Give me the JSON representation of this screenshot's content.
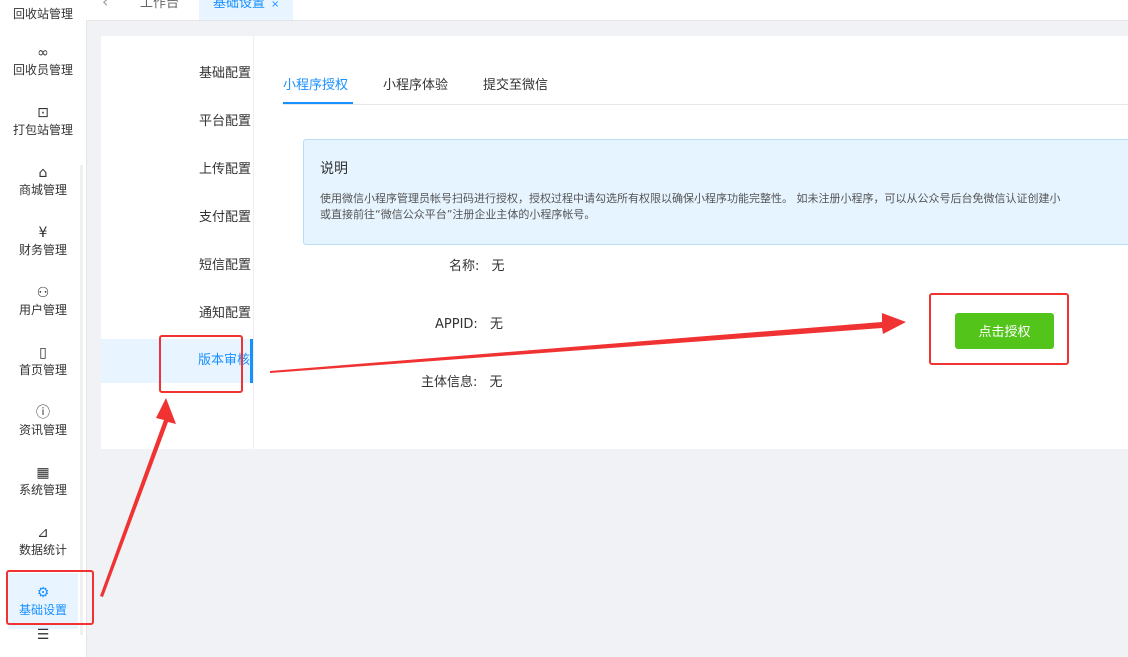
{
  "sidebar": {
    "items": [
      {
        "label": "回收站管理",
        "icon": "recycle-icon"
      },
      {
        "label": "回收员管理",
        "icon": "infinity-icon",
        "glyph": "∞"
      },
      {
        "label": "打包站管理",
        "icon": "package-icon",
        "glyph": "⊡"
      },
      {
        "label": "商城管理",
        "icon": "shopping-bag-icon",
        "glyph": "⌂"
      },
      {
        "label": "财务管理",
        "icon": "yuan-icon",
        "glyph": "¥"
      },
      {
        "label": "用户管理",
        "icon": "users-icon",
        "glyph": "⚇"
      },
      {
        "label": "首页管理",
        "icon": "mobile-icon",
        "glyph": "▯"
      },
      {
        "label": "资讯管理",
        "icon": "info-icon",
        "glyph": "ⓘ"
      },
      {
        "label": "系统管理",
        "icon": "grid-icon",
        "glyph": "▦"
      },
      {
        "label": "数据统计",
        "icon": "chart-icon",
        "glyph": "⊿"
      },
      {
        "label": "基础设置",
        "icon": "gear-icon",
        "glyph": "⚙"
      },
      {
        "label": "",
        "icon": "collapse-menu-icon",
        "glyph": "☰"
      }
    ]
  },
  "tabbar": {
    "back_glyph": "‹",
    "tabs": [
      {
        "label": "工作台"
      },
      {
        "label": "基础设置",
        "close": "×"
      }
    ]
  },
  "settings_menu": {
    "items": [
      {
        "label": "基础配置"
      },
      {
        "label": "平台配置"
      },
      {
        "label": "上传配置"
      },
      {
        "label": "支付配置"
      },
      {
        "label": "短信配置"
      },
      {
        "label": "通知配置"
      },
      {
        "label": "版本审核"
      }
    ]
  },
  "inner_tabs": [
    {
      "label": "小程序授权"
    },
    {
      "label": "小程序体验"
    },
    {
      "label": "提交至微信"
    }
  ],
  "notice": {
    "title": "说明",
    "line1": "使用微信小程序管理员帐号扫码进行授权，授权过程中请勾选所有权限以确保小程序功能完整性。 如未注册小程序，可以从公众号后台免微信认证创建小",
    "line2": "或直接前往“微信公众平台”注册企业主体的小程序帐号。"
  },
  "info": {
    "name_label": "名称:",
    "name_value": "无",
    "appid_label": "APPID:",
    "appid_value": "无",
    "entity_label": "主体信息:",
    "entity_value": "无"
  },
  "authorize_button": "点击授权",
  "colors": {
    "accent": "#1890ff",
    "button_green": "#52c41a",
    "annotation_red": "#f03232"
  }
}
